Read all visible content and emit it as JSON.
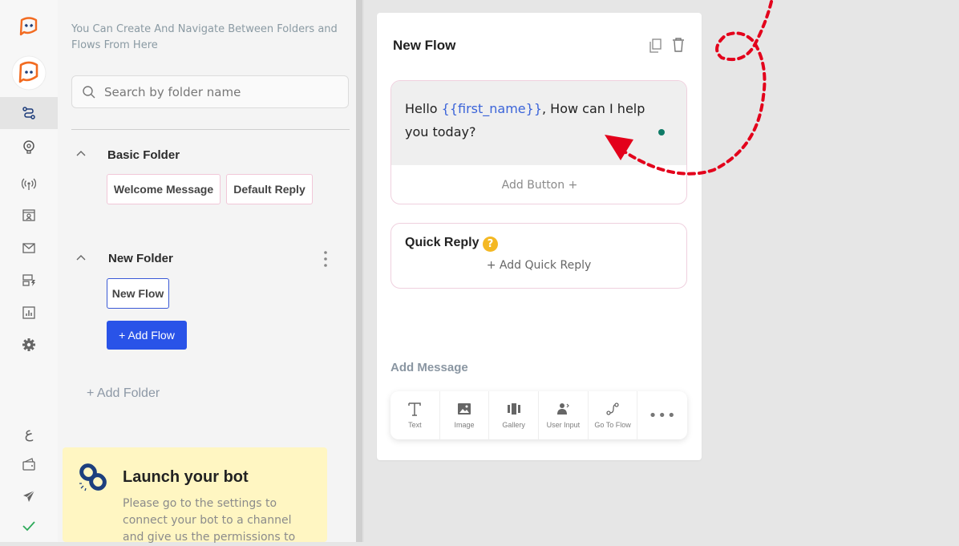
{
  "sidebar": {
    "icons": [
      "brand-logo-icon",
      "bot-avatar-icon",
      "flows-icon",
      "ai-brain-icon",
      "broadcast-icon",
      "contacts-icon",
      "mail-icon",
      "templates-icon",
      "analytics-icon",
      "settings-gear-icon",
      "arabic-language-icon",
      "wallet-icon",
      "send-icon",
      "check-icon"
    ],
    "language_glyph": "ع"
  },
  "folders_panel": {
    "intro": "You Can Create And Navigate Between Folders and Flows From Here",
    "search": {
      "placeholder": "Search by folder name",
      "value": ""
    },
    "folders": [
      {
        "name": "Basic Folder",
        "flows": [
          "Welcome Message",
          "Default Reply"
        ]
      },
      {
        "name": "New Folder",
        "flows": [
          "New Flow"
        ],
        "active_flow": "New Flow"
      }
    ],
    "add_flow": "+ Add Flow",
    "add_folder": "+ Add Folder",
    "launch": {
      "title": "Launch your bot",
      "body": "Please go to the settings to connect your bot to a channel and give us the permissions to"
    }
  },
  "flow": {
    "title": "New Flow",
    "message": {
      "prefix": "Hello ",
      "variable": "{{first_name}}",
      "suffix": ", How can I help you today?"
    },
    "add_button": "Add Button +",
    "quick_reply": {
      "title": "Quick Reply",
      "help": "?",
      "add": "+ Add Quick Reply"
    },
    "add_message_label": "Add Message",
    "tools": [
      {
        "label": "Text",
        "icon": "text-icon"
      },
      {
        "label": "Image",
        "icon": "image-icon"
      },
      {
        "label": "Gallery",
        "icon": "gallery-icon"
      },
      {
        "label": "User Input",
        "icon": "user-input-icon"
      },
      {
        "label": "Go To Flow",
        "icon": "go-to-flow-icon"
      }
    ],
    "more": "•••"
  },
  "colors": {
    "accent": "#2953e8",
    "brand": "#f26b21",
    "annotation": "#e3001b",
    "launch_bg": "#fff6c2"
  }
}
